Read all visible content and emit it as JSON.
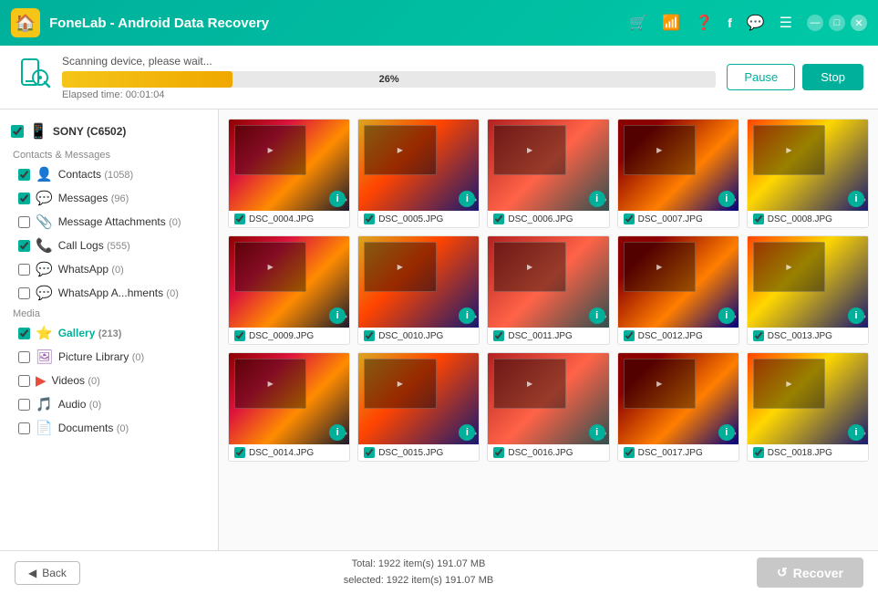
{
  "app": {
    "title": "FoneLab - Android Data Recovery"
  },
  "titlebar": {
    "logo": "🏠",
    "icons": [
      "🛒",
      "📶",
      "❓",
      "f",
      "💬",
      "☰"
    ],
    "win_min": "—",
    "win_max": "□",
    "win_close": "✕"
  },
  "scan": {
    "status": "Scanning device, please wait...",
    "progress": 26,
    "progress_label": "26%",
    "elapsed_label": "Elapsed time: 00:01:04",
    "pause_label": "Pause",
    "stop_label": "Stop"
  },
  "sidebar": {
    "device_label": "SONY (C6502)",
    "sections": [
      {
        "title": "Contacts & Messages",
        "items": [
          {
            "label": "Contacts",
            "count": "(1058)",
            "icon": "👤",
            "color": "#e67e22",
            "checked": true
          },
          {
            "label": "Messages",
            "count": "(96)",
            "icon": "💬",
            "color": "#f1c40f",
            "checked": true
          },
          {
            "label": "Message Attachments",
            "count": "(0)",
            "icon": "📎",
            "color": "#2ecc71",
            "checked": false
          },
          {
            "label": "Call Logs",
            "count": "(555)",
            "icon": "📞",
            "color": "#27ae60",
            "checked": true
          },
          {
            "label": "WhatsApp",
            "count": "(0)",
            "icon": "W",
            "color": "#25d366",
            "checked": false
          },
          {
            "label": "WhatsApp A...hments",
            "count": "(0)",
            "icon": "W",
            "color": "#25d366",
            "checked": false
          }
        ]
      },
      {
        "title": "Media",
        "items": [
          {
            "label": "Gallery",
            "count": "(213)",
            "icon": "⭐",
            "color": "#f5c518",
            "checked": true,
            "active": true
          },
          {
            "label": "Picture Library",
            "count": "(0)",
            "icon": "🖼",
            "color": "#9b59b6",
            "checked": false
          },
          {
            "label": "Videos",
            "count": "(0)",
            "icon": "▶",
            "color": "#e74c3c",
            "checked": false
          },
          {
            "label": "Audio",
            "count": "(0)",
            "icon": "🎵",
            "color": "#e74c3c",
            "checked": false
          },
          {
            "label": "Documents",
            "count": "(0)",
            "icon": "📄",
            "color": "#f5c518",
            "checked": false
          }
        ]
      }
    ]
  },
  "photos": [
    {
      "name": "DSC_0004.JPG"
    },
    {
      "name": "DSC_0005.JPG"
    },
    {
      "name": "DSC_0006.JPG"
    },
    {
      "name": "DSC_0007.JPG"
    },
    {
      "name": "DSC_0008.JPG"
    },
    {
      "name": "DSC_0009.JPG"
    },
    {
      "name": "DSC_0010.JPG"
    },
    {
      "name": "DSC_0011.JPG"
    },
    {
      "name": "DSC_0012.JPG"
    },
    {
      "name": "DSC_0013.JPG"
    },
    {
      "name": "DSC_0014.JPG"
    },
    {
      "name": "DSC_0015.JPG"
    },
    {
      "name": "DSC_0016.JPG"
    },
    {
      "name": "DSC_0017.JPG"
    },
    {
      "name": "DSC_0018.JPG"
    }
  ],
  "bottom": {
    "back_label": "Back",
    "total_line1": "Total: 1922 item(s)  191.07 MB",
    "total_line2": "selected: 1922 item(s)  191.07 MB",
    "recover_label": "Recover"
  }
}
